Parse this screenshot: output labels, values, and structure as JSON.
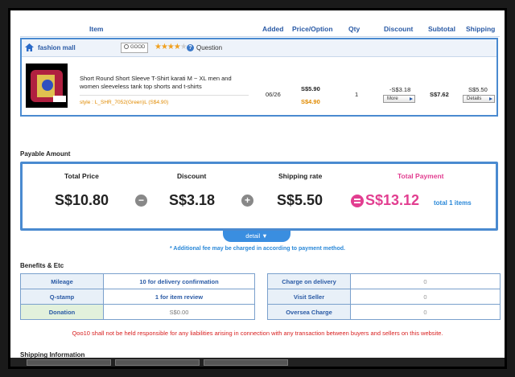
{
  "columns": {
    "item": "Item",
    "added": "Added",
    "price_option": "Price/Option",
    "qty": "Qty",
    "discount": "Discount",
    "subtotal": "Subtotal",
    "shipping": "Shipping"
  },
  "seller": {
    "name": "fashion mall",
    "badge": "GOOD",
    "rating_stars": 4,
    "rating_max": 5,
    "question_label": "Question"
  },
  "product": {
    "name": "Short Round Short Sleeve T-Shirt karati M ~ XL men and women sleeveless tank top shorts and t-shirts",
    "style": "style : L_SHR_7052(Green)L (S$4.90)",
    "added": "06/26",
    "price": "S$5.90",
    "option_price": "S$4.90",
    "qty": "1",
    "discount": "-S$3.18",
    "more_label": "More",
    "subtotal": "S$7.62",
    "shipping": "S$5.50",
    "details_label": "Details"
  },
  "payable": {
    "section_title": "Payable Amount",
    "total_price_label": "Total Price",
    "discount_label": "Discount",
    "shipping_rate_label": "Shipping rate",
    "total_payment_label": "Total Payment",
    "total_price": "S$10.80",
    "discount": "S$3.18",
    "shipping_rate": "S$5.50",
    "total_payment": "S$13.12",
    "total_items": "total 1 items",
    "detail_tab": "detail ▼",
    "fee_note": "* Additional fee may be charged in according to payment method."
  },
  "benefits": {
    "section_title": "Benefits & Etc",
    "left": [
      {
        "label": "Mileage",
        "value": "10 for delivery confirmation"
      },
      {
        "label": "Q-stamp",
        "value": "1 for item review"
      },
      {
        "label": "Donation",
        "value": "S$0.00"
      }
    ],
    "right": [
      {
        "label": "Charge on delivery",
        "value": "0"
      },
      {
        "label": "Visit Seller",
        "value": "0"
      },
      {
        "label": "Oversea Charge",
        "value": "0"
      }
    ]
  },
  "liability_note": "Qoo10 shall not be held responsible for any liabilities arising in connection with any transaction between buyers and sellers on this website.",
  "shipping_info_title": "Shipping Information",
  "colors": {
    "accent": "#2a5aa5",
    "border": "#4a8ad0",
    "pink": "#e23e90",
    "orange": "#e08a00",
    "red": "#d82020"
  }
}
